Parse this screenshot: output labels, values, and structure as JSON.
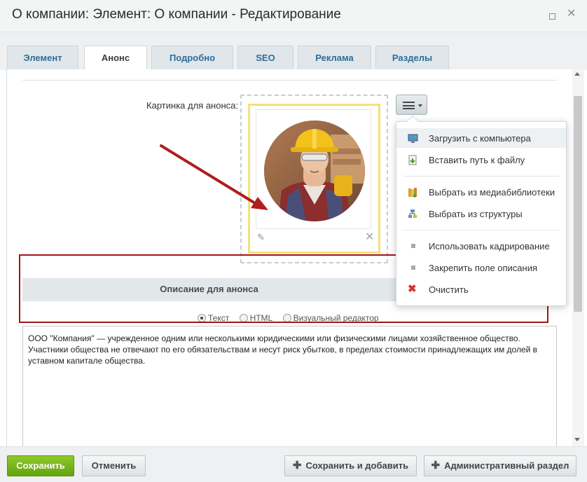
{
  "window": {
    "title": "О компании: Элемент: О компании - Редактирование"
  },
  "tabs": [
    {
      "label": "Элемент",
      "active": false
    },
    {
      "label": "Анонс",
      "active": true
    },
    {
      "label": "Подробно",
      "active": false
    },
    {
      "label": "SEO",
      "active": false
    },
    {
      "label": "Реклама",
      "active": false
    },
    {
      "label": "Разделы",
      "active": false
    }
  ],
  "preview_image": {
    "label": "Картинка для анонса:"
  },
  "description": {
    "section_title": "Описание для анонса",
    "modes": [
      {
        "label": "Текст",
        "checked": true
      },
      {
        "label": "HTML",
        "checked": false
      },
      {
        "label": "Визуальный редактор",
        "checked": false
      }
    ],
    "text": "ООО \"Компания\" — учрежденное одним или несколькими юридическими или физическими лицами хозяйственное общество. Участники общества не отвечают по его обязательствам и несут риск убытков, в пределах стоимости принадлежащих им долей в уставном капитале общества."
  },
  "image_menu": {
    "items": [
      {
        "label": "Загрузить с компьютера",
        "icon": "upload-computer-icon"
      },
      {
        "label": "Вставить путь к файлу",
        "icon": "file-path-icon"
      },
      {
        "label": "Выбрать из медиабиблиотеки",
        "icon": "medialibrary-icon"
      },
      {
        "label": "Выбрать из структуры",
        "icon": "structure-icon"
      },
      {
        "label": "Использовать кадрирование",
        "icon": "bullet-icon"
      },
      {
        "label": "Закрепить поле описания",
        "icon": "bullet-icon"
      },
      {
        "label": "Очистить",
        "icon": "clear-icon"
      }
    ]
  },
  "footer": {
    "save": "Сохранить",
    "cancel": "Отменить",
    "save_add": "Сохранить и добавить",
    "admin_section": "Административный раздел"
  },
  "colors": {
    "tab_link": "#2d6d99",
    "save_green": "#62a30d",
    "annotation_red": "#a31515",
    "highlight_yellow": "#f5e07a"
  }
}
